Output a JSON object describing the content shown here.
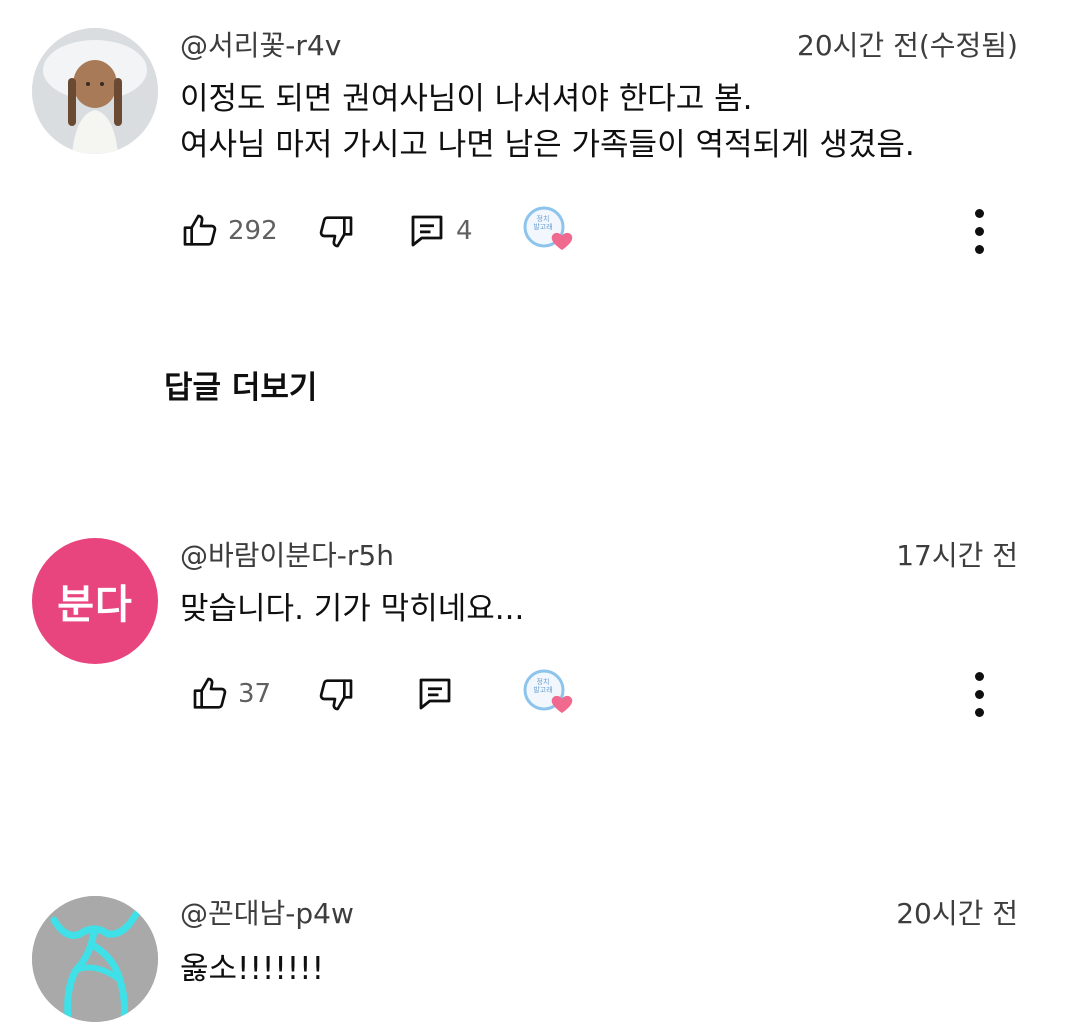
{
  "comments": [
    {
      "author": "@서리꽃-r4v",
      "time": "20시간 전(수정됨)",
      "text_lines": [
        "이정도 되면 권여사님이 나서셔야 한다고 봄.",
        "여사님 마저 가시고 나면 남은 가족들이 역적되게 생겼음."
      ],
      "likes": "292",
      "replies": "4",
      "avatar_icon": "doll-avatar-icon"
    },
    {
      "author": "@바람이분다-r5h",
      "time": "17시간 전",
      "text_lines": [
        "맞습니다. 기가 막히네요..."
      ],
      "likes": "37",
      "replies": "",
      "avatar_initials": "분다",
      "avatar_color": "#e8457f"
    },
    {
      "author": "@꼰대남-p4w",
      "time": "20시간 전",
      "text_lines": [
        "옳소!!!!!!!"
      ],
      "avatar_icon": "stick-figure-avatar-icon"
    }
  ],
  "more_replies_label": "답글 더보기",
  "creator_heart_badge_text": "정치\n발고래",
  "colors": {
    "text_primary": "#0f0f0f",
    "text_secondary": "#606060",
    "heart": "#f06a8f",
    "badge_ring": "#8cc4ec"
  }
}
